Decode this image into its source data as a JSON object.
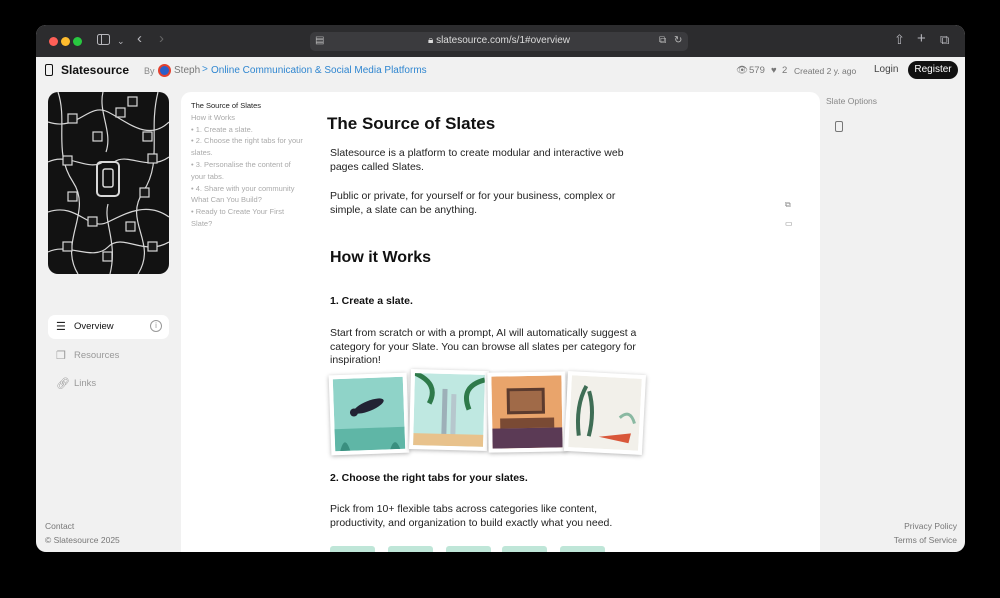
{
  "browser": {
    "url": "slatesource.com/s/1#overview"
  },
  "header": {
    "brand": "Slatesource",
    "by_label": "By",
    "author": "Steph",
    "breadcrumb_sep": ">",
    "category": "Online Communication & Social Media Platforms",
    "views": "579",
    "likes": "2",
    "created": "Created 2 y. ago",
    "login": "Login",
    "register": "Register"
  },
  "sidebar": {
    "items": [
      {
        "label": "Overview",
        "icon": "lines-icon",
        "active": true
      },
      {
        "label": "Resources",
        "icon": "copy-icon",
        "active": false
      },
      {
        "label": "Links",
        "icon": "link-icon",
        "active": false
      }
    ],
    "contact": "Contact",
    "copyright": "© Slatesource 2025"
  },
  "toc": [
    "The Source of Slates",
    "How it Works",
    "• 1. Create a slate.",
    "• 2. Choose the right tabs for your",
    "slates.",
    "• 3. Personalise the content of",
    "your tabs.",
    "• 4. Share with your community",
    "What Can You Build?",
    "• Ready to Create Your First",
    "Slate?"
  ],
  "article": {
    "title": "The Source of Slates",
    "p1": "Slatesource is a platform to create modular and interactive web pages called Slates.",
    "p2": "Public or private, for yourself or for your business, complex or simple, a slate can be anything.",
    "h2": "How it Works",
    "step1_title": "1. Create a slate.",
    "step1_text": "Start from scratch or with a prompt, AI will automatically suggest a category for your Slate. You can browse all slates per category for inspiration!",
    "step2_title": "2. Choose the right tabs for your slates.",
    "step2_text": "Pick from 10+ flexible tabs across categories like content, productivity, and organization to build exactly what you need."
  },
  "rightpanel": {
    "title": "Slate Options",
    "privacy": "Privacy Policy",
    "terms": "Terms of Service"
  },
  "colors": {
    "accent": "#2f86d0",
    "dark": "#111111"
  }
}
